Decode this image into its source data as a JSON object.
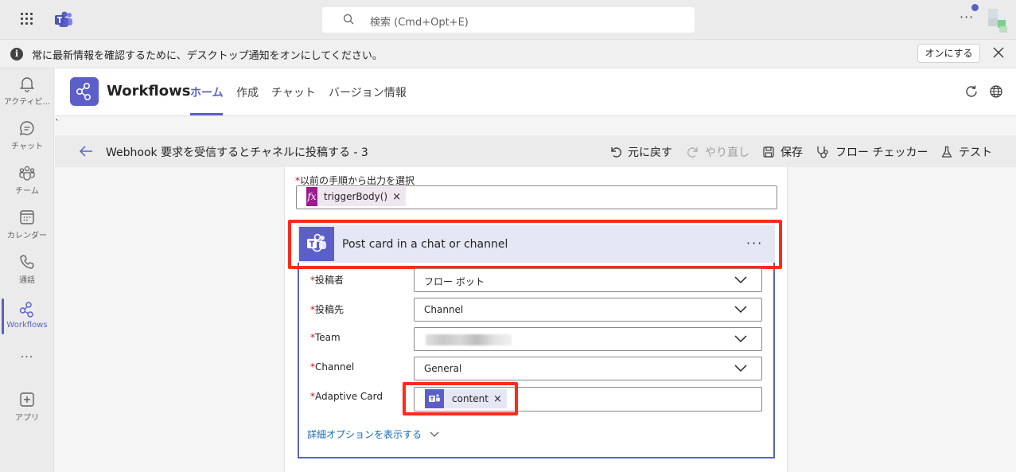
{
  "topbar": {
    "search_placeholder": "検索 (Cmd+Opt+E)",
    "more": "···"
  },
  "notification": {
    "text": "常に最新情報を確認するために、デスクトップ通知をオンにしてください。",
    "button": "オンにする",
    "info_glyph": "i"
  },
  "rail": {
    "items": [
      {
        "label": "アクティビ...",
        "icon": "bell-icon"
      },
      {
        "label": "チャット",
        "icon": "chat-icon"
      },
      {
        "label": "チーム",
        "icon": "teams-icon"
      },
      {
        "label": "カレンダー",
        "icon": "calendar-icon"
      },
      {
        "label": "通話",
        "icon": "phone-icon"
      },
      {
        "label": "Workflows",
        "icon": "workflows-icon",
        "active": true
      },
      {
        "label": "···",
        "icon": "more-icon"
      },
      {
        "label": "アプリ",
        "icon": "add-app-icon"
      }
    ]
  },
  "app": {
    "title": "Workflows",
    "tabs": [
      {
        "label": "ホーム",
        "active": true
      },
      {
        "label": "作成"
      },
      {
        "label": "チャット"
      },
      {
        "label": "バージョン情報"
      }
    ],
    "stray_mark": "`"
  },
  "command_bar": {
    "flow_title": "Webhook 要求を受信するとチャネルに投稿する - 3",
    "undo": "元に戻す",
    "redo": "やり直し",
    "save": "保存",
    "flow_checker": "フロー チェッカー",
    "test": "テスト"
  },
  "prev_step": {
    "required_mark": "*",
    "label": "以前の手順から出力を選択",
    "token_icon": "fx",
    "token_label": "triggerBody()",
    "token_remove": "×"
  },
  "action": {
    "title": "Post card in a chat or channel",
    "more": "···",
    "fields": [
      {
        "label": "投稿者",
        "value": "フロー ボット"
      },
      {
        "label": "投稿先",
        "value": "Channel"
      },
      {
        "label": "Team",
        "value": ""
      },
      {
        "label": "Channel",
        "value": "General"
      }
    ],
    "adaptive_card": {
      "label": "Adaptive Card",
      "token_label": "content",
      "token_remove": "×"
    },
    "advanced_link": "詳細オプションを表示する"
  },
  "colors": {
    "brand": "#5b5fc7",
    "highlight": "#ff2a1a",
    "required": "#c50f1f",
    "link": "#0f6cbd"
  }
}
